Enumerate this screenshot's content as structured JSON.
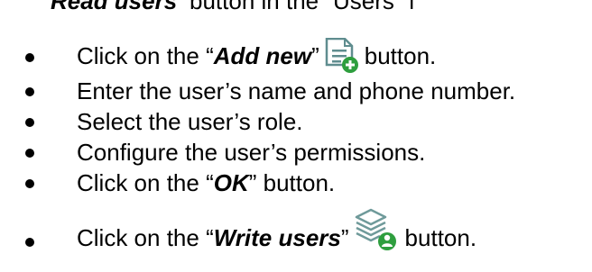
{
  "header_fragment": {
    "bold_italic": "Read users",
    "rest": "button in the “Users” f"
  },
  "steps": [
    {
      "prefix": "Click on the “",
      "emph": "Add new",
      "suffix_quote": "”",
      "icon": "add-document-icon",
      "tail": "button."
    },
    {
      "text": "Enter the user’s name and phone number."
    },
    {
      "text": "Select the user’s role."
    },
    {
      "text": "Configure the user’s permissions."
    },
    {
      "prefix": "Click on the “",
      "emph": "OK",
      "suffix_quote": "” button."
    },
    {
      "prefix": "Click on the “",
      "emph": "Write users",
      "suffix_quote": "”",
      "icon": "write-users-stack-icon",
      "tail": "button."
    }
  ],
  "colors": {
    "icon_green": "#2e9e3e",
    "icon_doc_outline": "#5f8d8f",
    "icon_stack": "#6f9a9a",
    "text": "#000000"
  }
}
